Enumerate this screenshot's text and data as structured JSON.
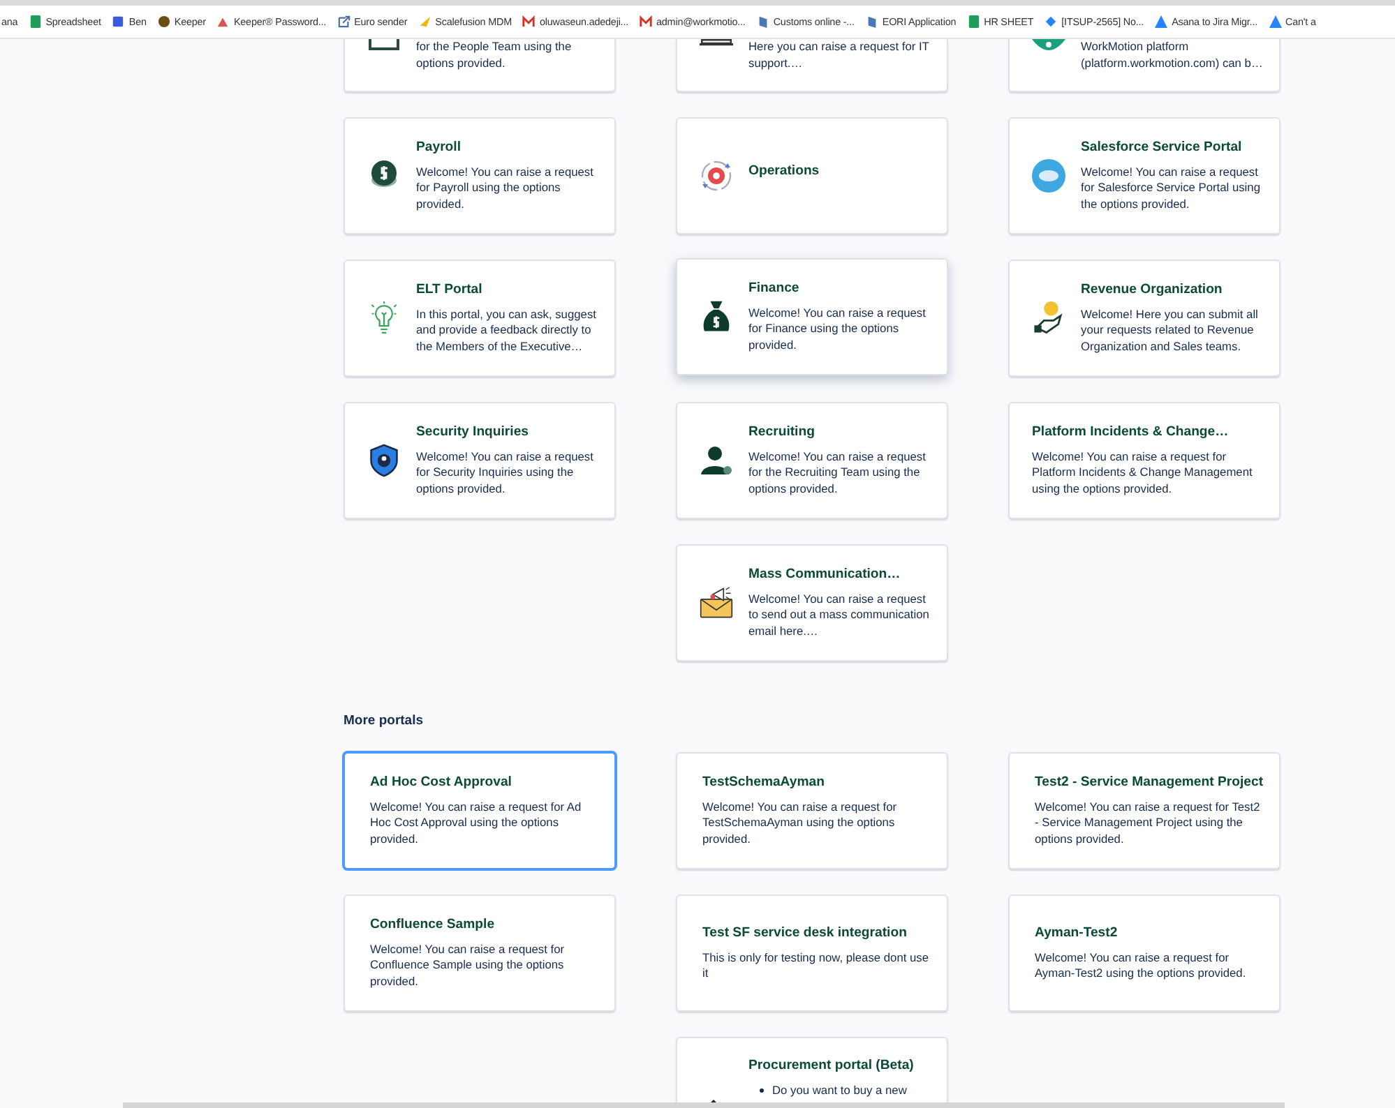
{
  "bookmarks": [
    {
      "label": "ana",
      "kind": "text"
    },
    {
      "label": "Spreadsheet",
      "kind": "sheet"
    },
    {
      "label": "Ben",
      "kind": "square"
    },
    {
      "label": "Keeper",
      "kind": "circle"
    },
    {
      "label": "Keeper® Password...",
      "kind": "house"
    },
    {
      "label": "Euro sender",
      "kind": "link"
    },
    {
      "label": "Scalefusion MDM",
      "kind": "wing"
    },
    {
      "label": "oluwaseun.adedeji...",
      "kind": "mail"
    },
    {
      "label": "admin@workmotio...",
      "kind": "mail"
    },
    {
      "label": "Customs online -...",
      "kind": "flag"
    },
    {
      "label": "EORI Application",
      "kind": "flag"
    },
    {
      "label": "HR SHEET",
      "kind": "sheet"
    },
    {
      "label": "[ITSUP-2565] No...",
      "kind": "diamond"
    },
    {
      "label": "Asana to Jira Migr...",
      "kind": "triangle"
    },
    {
      "label": "Can't a",
      "kind": "triangle"
    }
  ],
  "service_desks": [
    {
      "description": "for the People Team using the options provided.",
      "kind": "people",
      "hovered": false,
      "cut": true
    },
    {
      "description": "Here you can raise a request for IT support.…",
      "kind": "laptop",
      "hovered": false,
      "cut": true
    },
    {
      "description": "WorkMotion platform (platform.workmotion.com) can b…",
      "kind": "workmotion",
      "hovered": false,
      "cut": true
    },
    {
      "title": "Payroll",
      "description": "Welcome! You can raise a request for Payroll using the options provided.",
      "kind": "payroll",
      "hovered": false,
      "cut": false
    },
    {
      "title": "Operations",
      "kind": "operations",
      "hovered": false,
      "cut": false
    },
    {
      "title": "Salesforce Service Portal",
      "description": "Welcome! You can raise a request for Salesforce Service Portal using the options provided.",
      "kind": "salesforce",
      "hovered": false,
      "cut": false
    },
    {
      "title": "ELT Portal",
      "description": "In this portal, you can ask, suggest and provide a feedback directly to the Members of the Executive…",
      "kind": "bulb",
      "hovered": false,
      "cut": false
    },
    {
      "title": "Finance",
      "description": "Welcome! You can raise a request for Finance using the options provided.",
      "kind": "finance",
      "hovered": true,
      "cut": false
    },
    {
      "title": "Revenue Organization",
      "description": "Welcome! Here you can submit all your requests related to Revenue Organization and Sales teams.",
      "kind": "revenue",
      "hovered": false,
      "cut": false
    },
    {
      "title": "Security Inquiries",
      "description": "Welcome! You can raise a request for Security Inquiries using the options provided.",
      "kind": "security",
      "hovered": false,
      "cut": false
    },
    {
      "title": "Recruiting",
      "description": "Welcome! You can raise a request for the Recruiting Team using the options provided.",
      "kind": "recruiting",
      "hovered": false,
      "cut": false
    },
    {
      "title": "Platform Incidents & Change…",
      "description": "Welcome! You can raise a request for Platform Incidents & Change Management using the options provided.",
      "kind": "plain",
      "hovered": false,
      "cut": false
    },
    {
      "title": "Mass Communication…",
      "description": "Welcome! You can raise a request to send out a mass communication email here.…",
      "kind": "megaphone",
      "hovered": false,
      "cut": false
    }
  ],
  "more_portals": {
    "heading": "More portals",
    "items": [
      {
        "title": "Ad Hoc Cost Approval",
        "description": "Welcome! You can raise a request for Ad Hoc Cost Approval using the options provided.",
        "selected": true
      },
      {
        "title": "TestSchemaAyman",
        "description": "Welcome! You can raise a request for TestSchemaAyman using the options provided.",
        "selected": false
      },
      {
        "title": "Test2 - Service Management Project",
        "description": "Welcome! You can raise a request for Test2 - Service Management Project using the options provided.",
        "selected": false
      },
      {
        "title": "Confluence Sample",
        "description": "Welcome! You can raise a request for Confluence Sample using the options provided.",
        "selected": false
      },
      {
        "title": "Test SF service desk integration",
        "description": "This is only for testing now, please dont use it",
        "selected": false
      },
      {
        "title": "Ayman-Test2",
        "description": "Welcome! You can raise a request for Ayman-Test2 using the options provided.",
        "selected": false
      }
    ],
    "last": {
      "title": "Procurement portal (Beta)",
      "bullets": [
        "Do you want to buy a new"
      ],
      "kind": "gavel"
    }
  }
}
